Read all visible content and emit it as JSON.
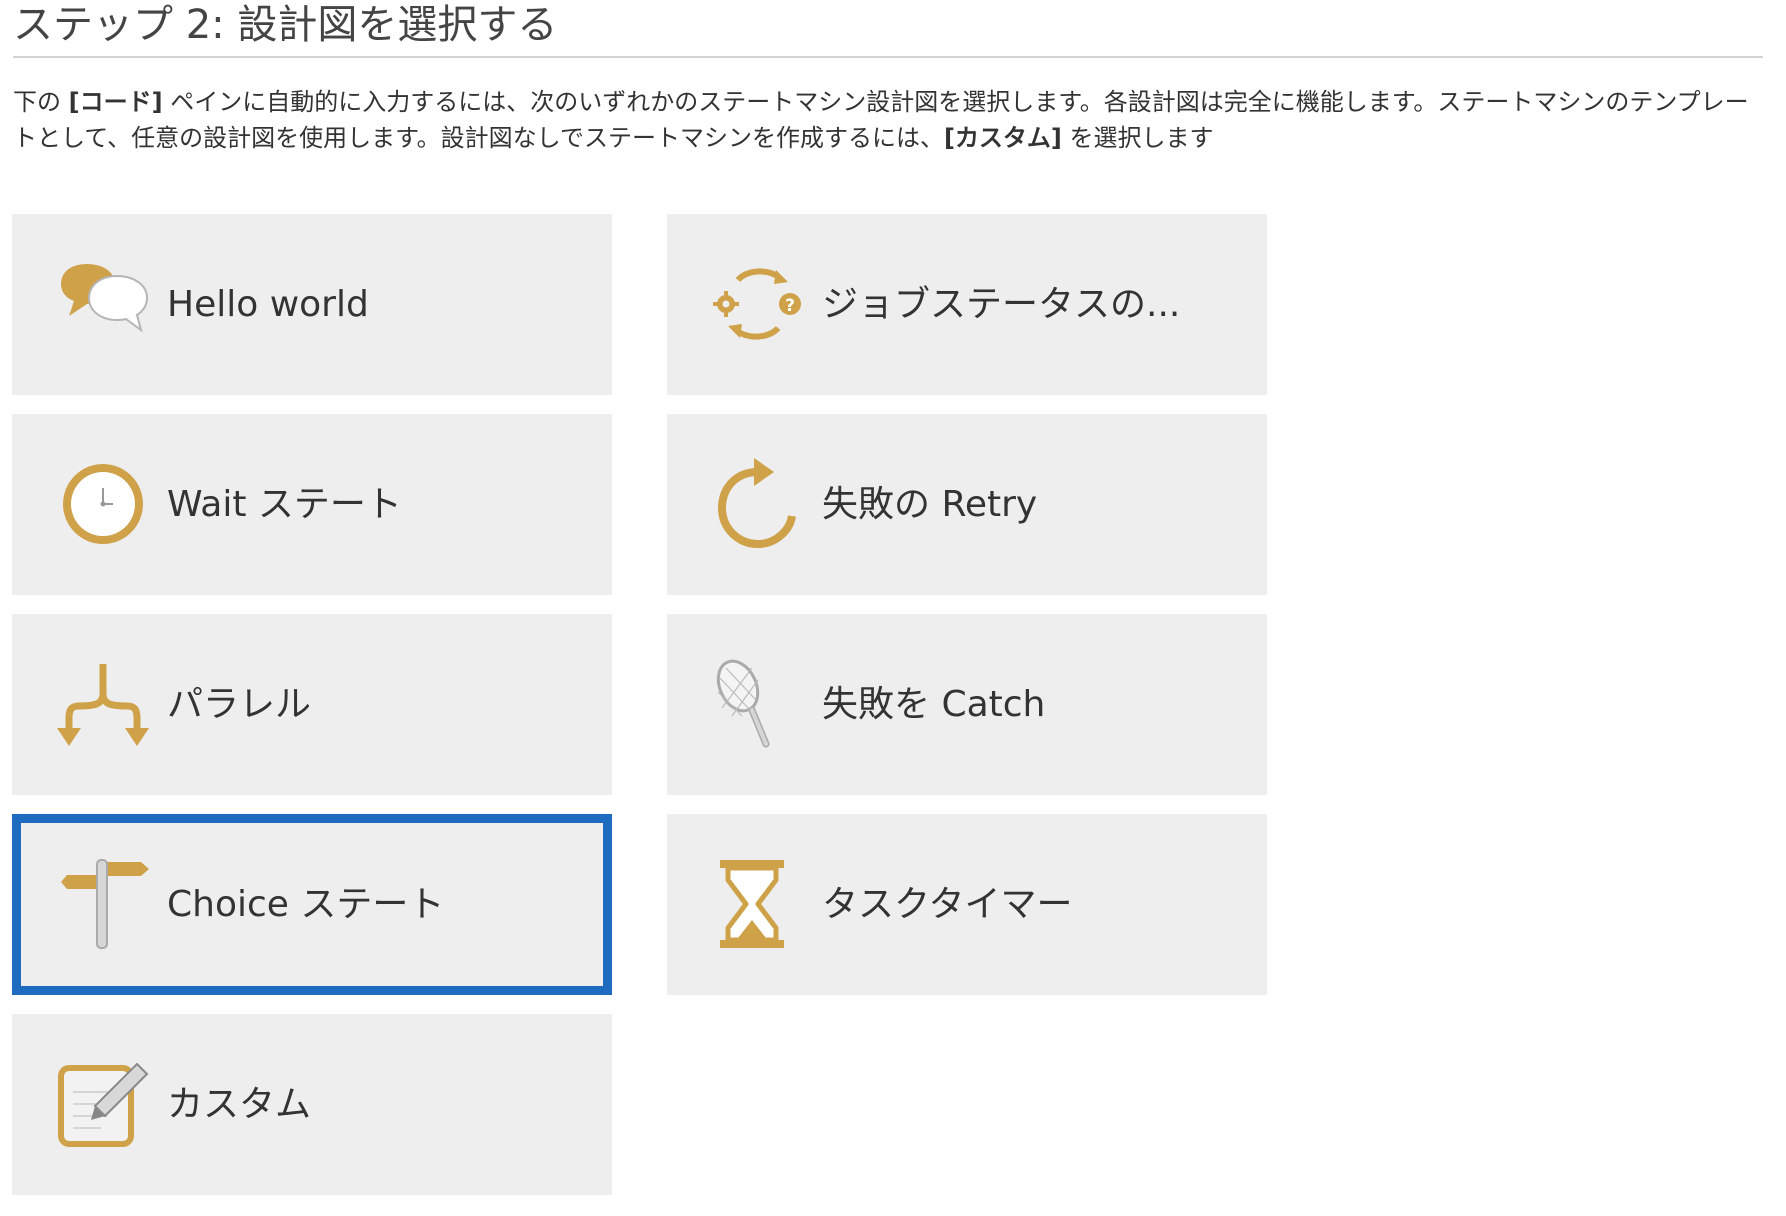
{
  "header": {
    "title": "ステップ 2: 設計図を選択する"
  },
  "intro": {
    "part1": "下の ",
    "code_label": "[コード]",
    "part2": " ペインに自動的に入力するには、次のいずれかのステートマシン設計図を選択します。各設計図は完全に機能します。ステートマシンのテンプレートとして、任意の設計図を使用します。設計図なしでステートマシンを作成するには、",
    "custom_label": "[カスタム]",
    "part3": " を選択します"
  },
  "colors": {
    "accent_gold": "#cfa24a",
    "selected_border": "#1f6bbf",
    "tile_bg": "#eeeeee"
  },
  "blueprints": {
    "hello_world": {
      "label": "Hello world",
      "icon": "speech-bubbles-icon"
    },
    "wait_state": {
      "label": "Wait ステート",
      "icon": "clock-icon"
    },
    "parallel": {
      "label": "パラレル",
      "icon": "split-arrows-icon"
    },
    "choice_state": {
      "label": "Choice ステート",
      "icon": "signpost-icon",
      "selected": true
    },
    "custom": {
      "label": "カスタム",
      "icon": "notepad-pencil-icon"
    },
    "job_status": {
      "label": "ジョブステータスの...",
      "icon": "cycle-gear-question-icon"
    },
    "retry_failure": {
      "label": "失敗の Retry",
      "icon": "retry-arrow-icon"
    },
    "catch_failure": {
      "label": "失敗を Catch",
      "icon": "net-icon"
    },
    "task_timer": {
      "label": "タスクタイマー",
      "icon": "hourglass-icon"
    }
  }
}
